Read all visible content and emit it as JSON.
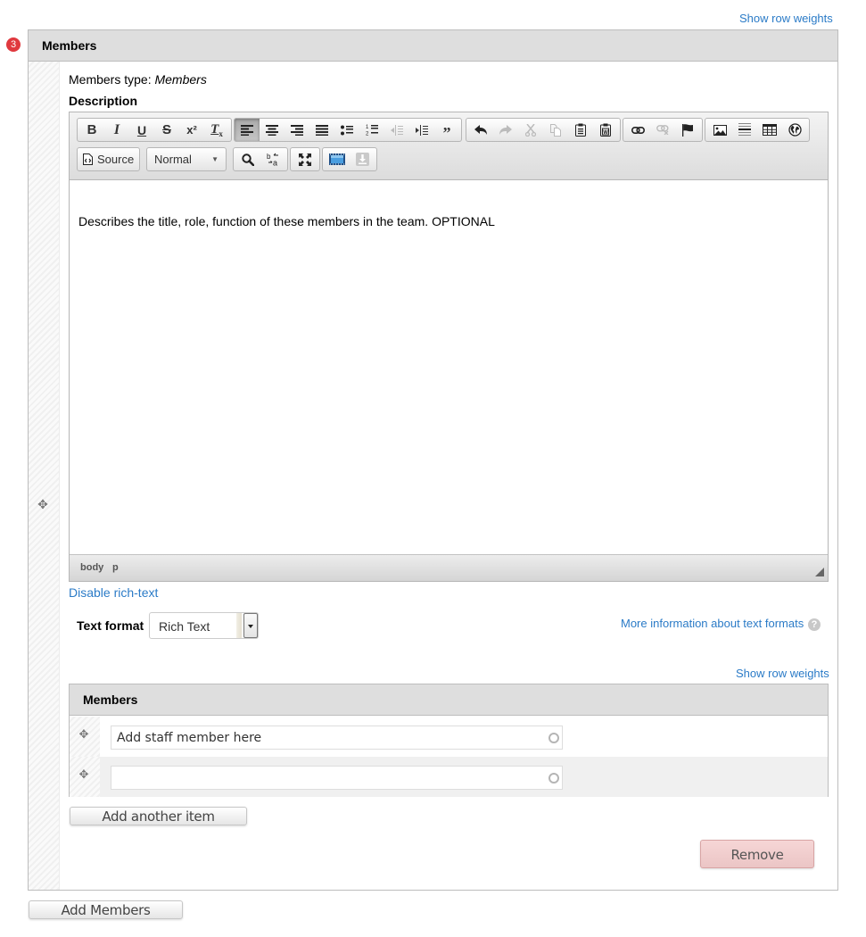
{
  "links": {
    "show_row_weights_top": "Show row weights",
    "show_row_weights_inner": "Show row weights",
    "disable_rich_text": "Disable rich-text",
    "more_info_text_formats": "More information about text formats"
  },
  "error_badge": "3",
  "section": {
    "title": "Members",
    "members_type_label": "Members type:",
    "members_type_value": "Members",
    "description_label": "Description"
  },
  "editor": {
    "toolbar_groups": [
      {
        "name": "basic-styles",
        "buttons": [
          {
            "icon": "bold-icon",
            "glyph": "B"
          },
          {
            "icon": "italic-icon",
            "glyph": "I"
          },
          {
            "icon": "underline-icon",
            "glyph": "U"
          },
          {
            "icon": "strikethrough-icon",
            "glyph": "S"
          },
          {
            "icon": "superscript-icon",
            "glyph": "x²"
          },
          {
            "icon": "remove-format-icon",
            "glyph": "Tx"
          }
        ]
      },
      {
        "name": "paragraph",
        "buttons": [
          {
            "icon": "align-left-icon",
            "active": true
          },
          {
            "icon": "align-center-icon"
          },
          {
            "icon": "align-right-icon"
          },
          {
            "icon": "justify-icon"
          },
          {
            "icon": "bulleted-list-icon"
          },
          {
            "icon": "numbered-list-icon"
          },
          {
            "icon": "outdent-icon",
            "disabled": true
          },
          {
            "icon": "indent-icon"
          },
          {
            "icon": "blockquote-icon",
            "glyph": "❞"
          }
        ]
      },
      {
        "name": "clipboard",
        "buttons": [
          {
            "icon": "undo-icon"
          },
          {
            "icon": "redo-icon",
            "disabled": true
          },
          {
            "icon": "cut-icon",
            "disabled": true
          },
          {
            "icon": "copy-icon",
            "disabled": true
          },
          {
            "icon": "paste-icon"
          },
          {
            "icon": "paste-from-word-icon"
          }
        ]
      },
      {
        "name": "links",
        "buttons": [
          {
            "icon": "link-icon"
          },
          {
            "icon": "unlink-icon",
            "disabled": true
          },
          {
            "icon": "anchor-icon"
          }
        ]
      },
      {
        "name": "insert",
        "buttons": [
          {
            "icon": "image-icon"
          },
          {
            "icon": "horizontal-rule-icon"
          },
          {
            "icon": "table-icon"
          },
          {
            "icon": "globe-icon"
          }
        ]
      }
    ],
    "source_label": "Source",
    "format_value": "Normal",
    "content": "Describes the title, role, function of these members in the team. OPTIONAL",
    "path": [
      "body",
      "p"
    ]
  },
  "text_format": {
    "label": "Text format",
    "selected": "Rich Text"
  },
  "members_table": {
    "title": "Members",
    "rows": [
      {
        "value": "Add staff member here"
      },
      {
        "value": ""
      }
    ]
  },
  "buttons": {
    "add_another_item": "Add another item",
    "remove": "Remove",
    "add_members": "Add Members"
  }
}
